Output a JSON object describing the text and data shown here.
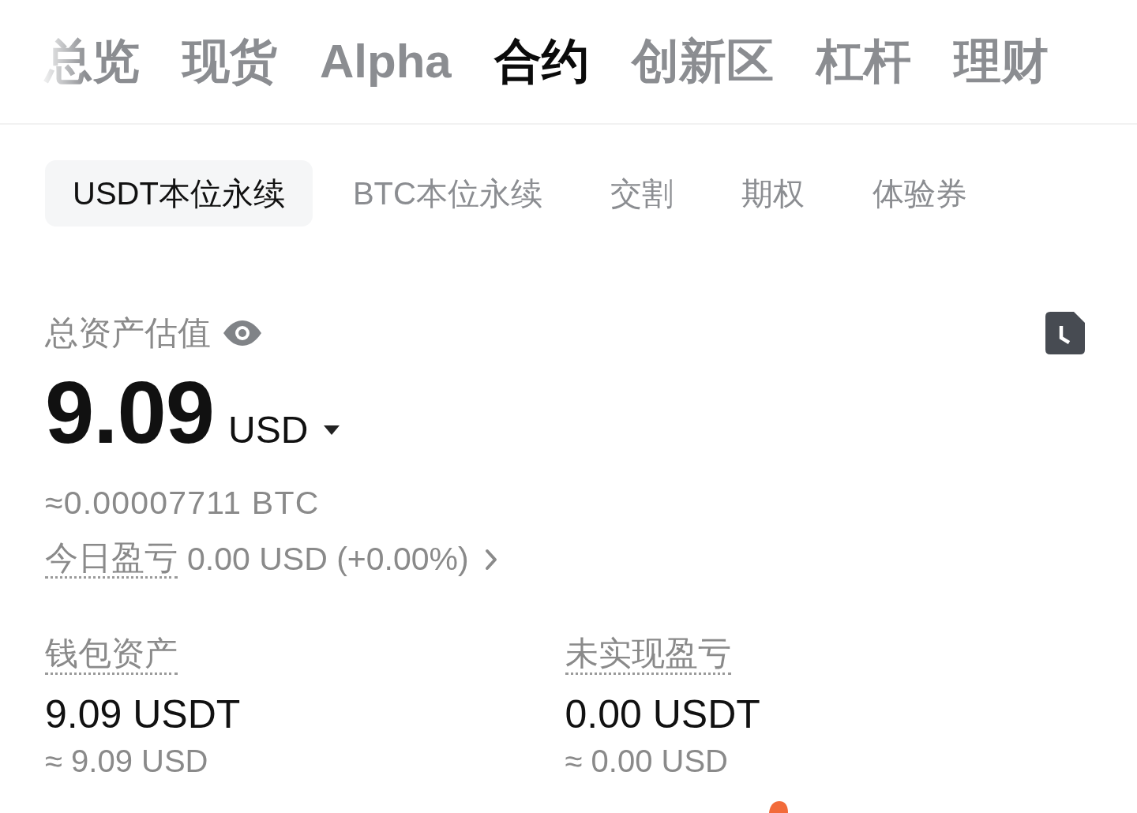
{
  "top_tabs": [
    {
      "label": "总览",
      "selected": false
    },
    {
      "label": "现货",
      "selected": false
    },
    {
      "label": "Alpha",
      "selected": false
    },
    {
      "label": "合约",
      "selected": true
    },
    {
      "label": "创新区",
      "selected": false
    },
    {
      "label": "杠杆",
      "selected": false
    },
    {
      "label": "理财",
      "selected": false
    }
  ],
  "sub_tabs": [
    {
      "label": "USDT本位永续",
      "selected": true
    },
    {
      "label": "BTC本位永续",
      "selected": false
    },
    {
      "label": "交割",
      "selected": false
    },
    {
      "label": "期权",
      "selected": false
    },
    {
      "label": "体验券",
      "selected": false
    }
  ],
  "total": {
    "label": "总资产估值",
    "amount": "9.09",
    "currency": "USD",
    "btc_equiv": "≈0.00007711 BTC",
    "today_pnl_label": "今日盈亏",
    "today_pnl_value": "0.00 USD (+0.00%)"
  },
  "stats": [
    {
      "label": "钱包资产",
      "value": "9.09 USDT",
      "equiv": "≈ 9.09 USD"
    },
    {
      "label": "未实现盈亏",
      "value": "0.00 USDT",
      "equiv": "≈ 0.00 USD"
    }
  ]
}
